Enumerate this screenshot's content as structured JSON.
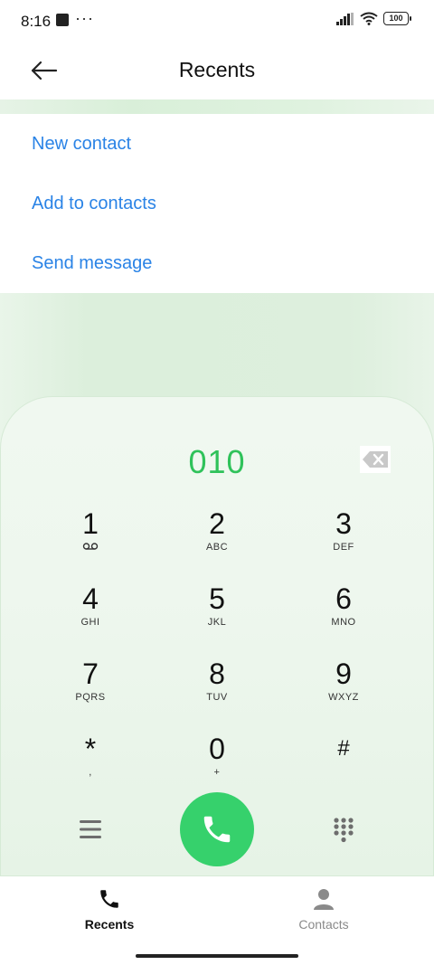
{
  "status_bar": {
    "time": "8:16",
    "more": "···",
    "battery": "100"
  },
  "header": {
    "title": "Recents"
  },
  "menu": {
    "items": [
      {
        "label": "New contact"
      },
      {
        "label": "Add to contacts"
      },
      {
        "label": "Send message"
      }
    ]
  },
  "dialer": {
    "number": "010",
    "keys": [
      {
        "digit": "1",
        "letters": ""
      },
      {
        "digit": "2",
        "letters": "ABC"
      },
      {
        "digit": "3",
        "letters": "DEF"
      },
      {
        "digit": "4",
        "letters": "GHI"
      },
      {
        "digit": "5",
        "letters": "JKL"
      },
      {
        "digit": "6",
        "letters": "MNO"
      },
      {
        "digit": "7",
        "letters": "PQRS"
      },
      {
        "digit": "8",
        "letters": "TUV"
      },
      {
        "digit": "9",
        "letters": "WXYZ"
      },
      {
        "digit": "*",
        "letters": ","
      },
      {
        "digit": "0",
        "letters": "+"
      },
      {
        "digit": "#",
        "letters": ""
      }
    ]
  },
  "tabs": [
    {
      "label": "Recents",
      "active": true
    },
    {
      "label": "Contacts",
      "active": false
    }
  ],
  "colors": {
    "accent_blue": "#2a83e6",
    "number_green": "#2fc25a",
    "call_green": "#36d16c"
  }
}
